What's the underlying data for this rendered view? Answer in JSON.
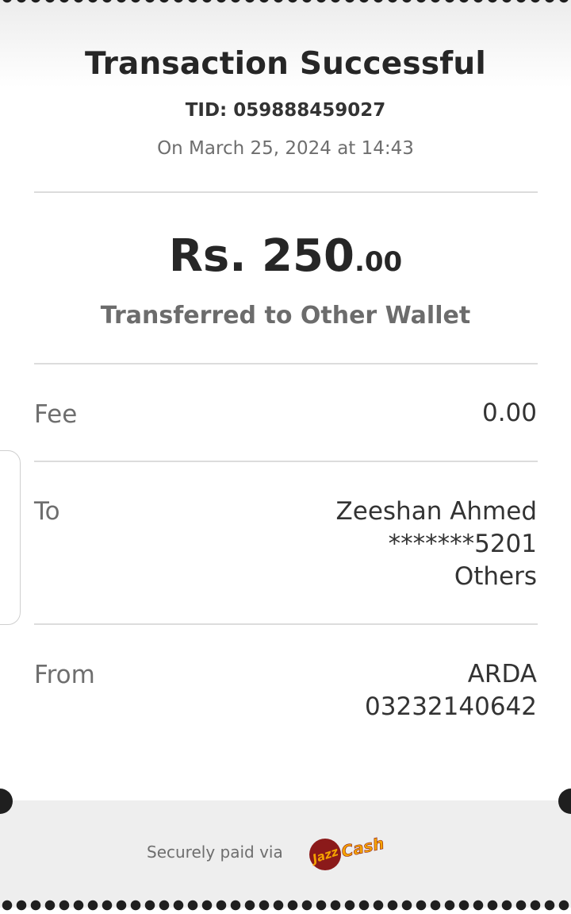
{
  "receipt": {
    "title": "Transaction Successful",
    "tid": "TID: 059888459027",
    "date": "On March 25, 2024 at 14:43",
    "amount_main": "Rs. 250",
    "amount_decimal": ".00",
    "description": "Transferred to Other Wallet",
    "fee": {
      "label": "Fee",
      "value": "0.00"
    },
    "to": {
      "label": "To",
      "name": "Zeeshan Ahmed",
      "account": "*******5201",
      "type": "Others"
    },
    "from": {
      "label": "From",
      "name": "ARDA",
      "number": "03232140642"
    }
  },
  "footer": {
    "secure_text": "Securely paid via",
    "logo_text_jazz": "Jazz",
    "logo_text_cash": "Cash",
    "logo_icon": "jazzcash-logo"
  },
  "colors": {
    "brand_red": "#8b1a1a",
    "brand_orange": "#f5a300"
  }
}
